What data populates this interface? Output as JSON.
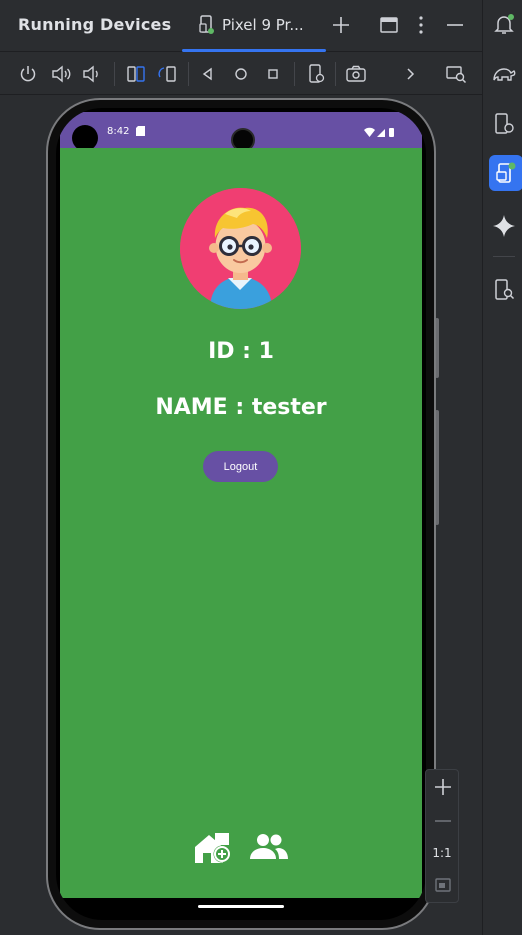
{
  "panel": {
    "title": "Running Devices",
    "tab_label": "Pixel 9 Pr..."
  },
  "header_icons": [
    "add-icon",
    "window-icon",
    "more-vertical-icon",
    "minimize-icon"
  ],
  "toolbar": {
    "buttons": [
      "power-icon",
      "volume-up-icon",
      "volume-down-icon",
      "rotate-left-icon",
      "rotate-right-icon",
      "back-icon",
      "home-icon",
      "overview-icon",
      "device-settings-icon",
      "screenshot-icon",
      "chevron-right-icon",
      "layout-inspector-icon"
    ]
  },
  "sidebar": {
    "items": [
      "notifications-icon",
      "gradle-icon",
      "device-manager-icon",
      "running-devices-icon",
      "gemini-icon",
      "device-explorer-icon"
    ]
  },
  "device": {
    "status_time": "8:42"
  },
  "app": {
    "id_text": "ID : 1",
    "name_text": "NAME : tester",
    "logout_label": "Logout",
    "bottom_nav": [
      "add-home-icon",
      "people-icon"
    ]
  },
  "zoom": {
    "actual_size_label": "1:1"
  },
  "colors": {
    "ide_bg": "#2b2d30",
    "accent": "#3574f0",
    "status_bar": "#6750a4",
    "app_bg": "#43a047",
    "button": "#6750a4",
    "avatar_bg": "#f03e72"
  }
}
